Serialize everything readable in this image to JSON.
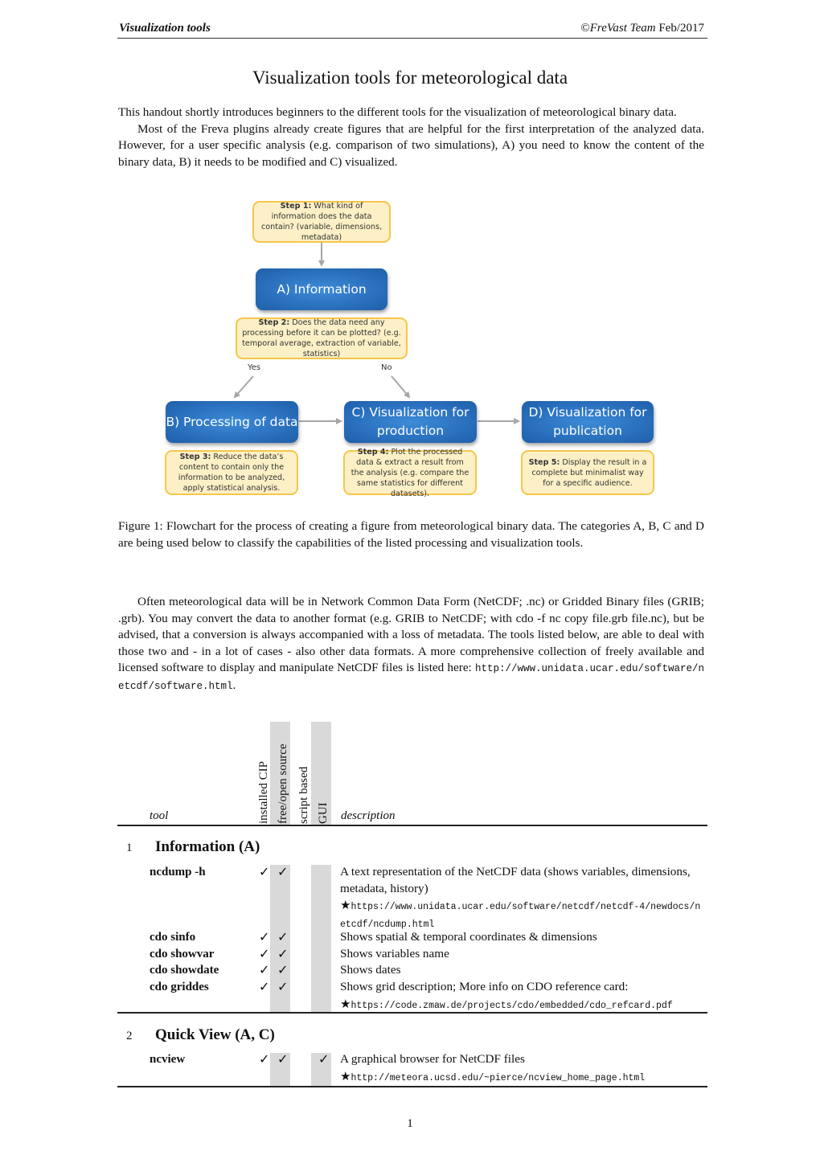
{
  "header": {
    "left": "Visualization tools",
    "copyright_symbol": "©",
    "team": "FreVast Team",
    "date": "Feb/2017"
  },
  "title": "Visualization tools for meteorological data",
  "intro": {
    "p1": "This handout shortly introduces beginners to the different tools for the visualization of meteorological binary data.",
    "p2": "Most of the Freva plugins already create figures that are helpful for the first interpretation of the analyzed data. However, for a user specific analysis (e.g. comparison of two simulations), A) you need to know the content of the binary data, B) it needs to be modified and C) visualized."
  },
  "flowchart": {
    "step1": {
      "lead": "Step 1:",
      "text": " What kind of information does the data contain? (variable, dimensions, metadata)"
    },
    "boxA": "A) Information",
    "step2": {
      "lead": "Step 2:",
      "text": " Does the data need any processing before it can be plotted? (e.g. temporal average, extraction of variable, statistics)"
    },
    "yes": "Yes",
    "no": "No",
    "boxB": "B) Processing of data",
    "boxC": "C) Visualization for production",
    "boxD": "D) Visualization for publication",
    "step3": {
      "lead": "Step 3:",
      "text": " Reduce the data’s content to contain only the information to be analyzed, apply statistical analysis."
    },
    "step4": {
      "lead": "Step 4:",
      "text": " Plot the processed data & extract a result from the analysis (e.g. compare the same statistics for different datasets)."
    },
    "step5": {
      "lead": "Step 5:",
      "text": " Display the result in a complete but minimalist way for a specific audience."
    },
    "colors": {
      "box_blue": "#2b72c0",
      "step_fill": "#fdf0c6",
      "step_border": "#f5c64a",
      "arrow": "#a6a6a6"
    }
  },
  "caption": "Figure 1: Flowchart for the process of creating a figure from meteorological binary data. The categories A, B, C and D are being used below to classify the capabilities of the listed processing and visualization tools.",
  "formats_paragraph": {
    "text": "Often meteorological data will be in Network Common Data Form (NetCDF; .nc) or Gridded Binary files (GRIB; .grb). You may convert the data to another format (e.g. GRIB to NetCDF; with cdo -f nc copy file.grb file.nc), but be advised, that a conversion is always accompanied with a loss of metadata. The tools listed below, are able to deal with those two and - in a lot of cases - also other data formats. A more comprehensive collection of freely available and licensed software to display and manipulate NetCDF files is listed here: ",
    "url": "http://www.unidata.ucar.edu/software/netcdf/software.html",
    "end": "."
  },
  "table": {
    "headers": {
      "tool": "tool",
      "installed": "installed CIP",
      "free": "free/open source",
      "script": "script based",
      "gui": "GUI",
      "description": "description"
    },
    "check_glyph": "✓",
    "star_glyph": "★",
    "sections": [
      {
        "number": "1",
        "title": "Information (A)",
        "rows": [
          {
            "tool": "ncdump -h",
            "installed": true,
            "free": true,
            "script": false,
            "gui": false,
            "description": "A text representation of the NetCDF data (shows variables, dimensions, metadata, history)",
            "url": "https://www.unidata.ucar.edu/software/netcdf/netcdf-4/newdocs/netcdf/ncdump.html"
          },
          {
            "tool": "cdo sinfo",
            "installed": true,
            "free": true,
            "script": false,
            "gui": false,
            "description": "Shows spatial & temporal coordinates & dimensions"
          },
          {
            "tool": "cdo showvar",
            "installed": true,
            "free": true,
            "script": false,
            "gui": false,
            "description": "Shows variables name"
          },
          {
            "tool": "cdo showdate",
            "installed": true,
            "free": true,
            "script": false,
            "gui": false,
            "description": "Shows dates"
          },
          {
            "tool": "cdo griddes",
            "installed": true,
            "free": true,
            "script": false,
            "gui": false,
            "description": "Shows grid description; More info on CDO reference card:",
            "url": "https://code.zmaw.de/projects/cdo/embedded/cdo_refcard.pdf"
          }
        ]
      },
      {
        "number": "2",
        "title": "Quick View (A, C)",
        "rows": [
          {
            "tool": "ncview",
            "installed": true,
            "free": true,
            "script": false,
            "gui": true,
            "description": "A graphical browser for NetCDF files",
            "url": "http://meteora.ucsd.edu/~pierce/ncview_home_page.html"
          }
        ]
      }
    ]
  },
  "page_number": "1"
}
